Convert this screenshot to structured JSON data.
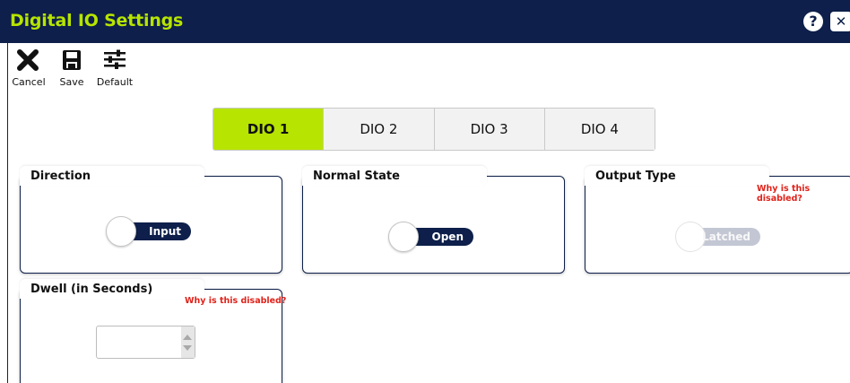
{
  "window": {
    "title": "Digital IO Settings",
    "help_icon": "help-icon",
    "help_glyph": "?",
    "close_icon": "close-icon",
    "close_glyph": "✕"
  },
  "toolbar": {
    "cancel_label": "Cancel",
    "save_label": "Save",
    "default_label": "Default"
  },
  "tabs": [
    {
      "label": "DIO 1",
      "active": true
    },
    {
      "label": "DIO 2",
      "active": false
    },
    {
      "label": "DIO 3",
      "active": false
    },
    {
      "label": "DIO 4",
      "active": false
    }
  ],
  "direction": {
    "label": "Direction",
    "value": "Input"
  },
  "normal_state": {
    "label": "Normal State",
    "value": "Open"
  },
  "output_type": {
    "label": "Output Type",
    "value": "Latched",
    "disabled": true,
    "why_disabled": "Why is this disabled?"
  },
  "dwell": {
    "label": "Dwell (in Seconds)",
    "value": "",
    "disabled": true,
    "why_disabled": "Why is this disabled?"
  },
  "colors": {
    "brand_navy": "#0d1f4a",
    "accent_green": "#b7e400",
    "warning_red": "#e0221a"
  }
}
